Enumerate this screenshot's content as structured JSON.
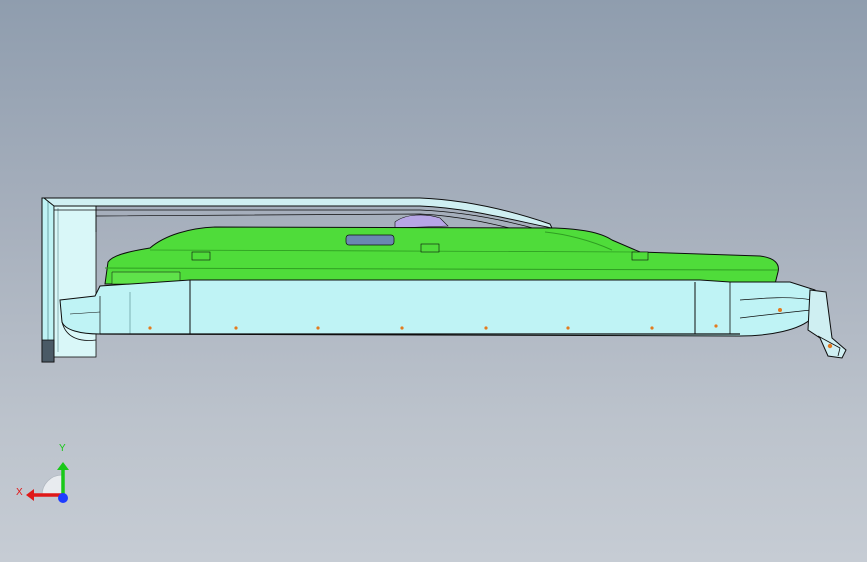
{
  "viewport": {
    "background_top": "#8f9dae",
    "background_bottom": "#c6ccd4"
  },
  "model": {
    "colors": {
      "green_body": "#4fdc3a",
      "green_dark": "#2f9e22",
      "cyan_body": "#bff3f5",
      "cyan_edge": "#7fcfd6",
      "outline": "#0d0d0d",
      "lavender_part": "#b7a6e6",
      "marker_orange": "#e37a1e"
    }
  },
  "triad": {
    "x_label": "X",
    "y_label": "Y",
    "x_color": "#e01818",
    "y_color": "#18c818",
    "z_color": "#1e3cff"
  }
}
